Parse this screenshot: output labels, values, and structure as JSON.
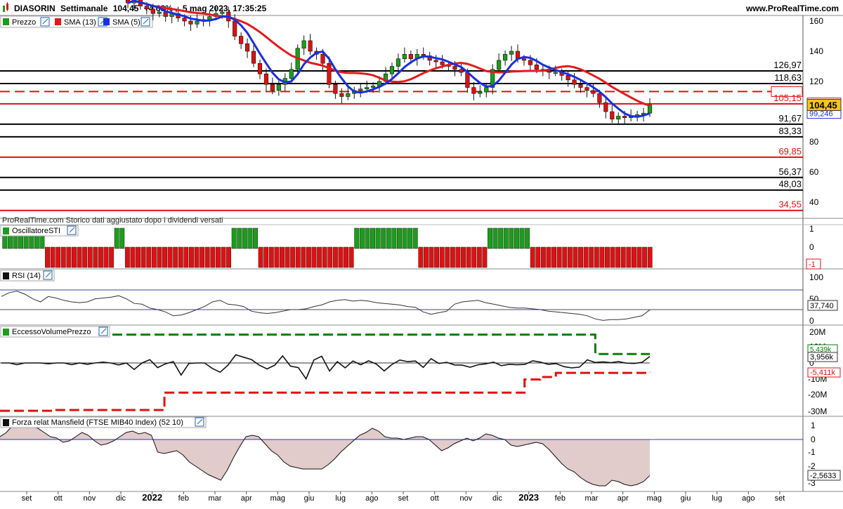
{
  "header": {
    "instrument": "DIASORIN",
    "timeframe": "Settimanale",
    "last": "104,45",
    "change": "+4,68%",
    "datetime": "5 mag 2023, 17:35:25",
    "website": "www.ProRealTime.com"
  },
  "colors": {
    "up": "#1a9e1a",
    "down": "#e01010",
    "sma13": "#e31a1a",
    "sma5": "#1a2fe0",
    "tag_yellow": "#f5c518",
    "area_fill": "#c9a0a0",
    "green_dash": "#0a7d0a",
    "red_dash": "#e01010"
  },
  "price_panel": {
    "legend": [
      "Prezzo",
      "SMA (13)",
      "SMA (5)"
    ],
    "y_ticks": [
      "160",
      "140",
      "120",
      "100",
      "80",
      "60",
      "40"
    ],
    "footer_note": "ProRealTime.com Storico dati aggiustato dopo i dividendi versati",
    "levels": [
      {
        "label": "126,97",
        "value": 126.97,
        "color": "#000000",
        "dashed": false
      },
      {
        "label": "118,63",
        "value": 118.63,
        "color": "#000000",
        "dashed": false
      },
      {
        "label": "113,30",
        "value": 113.3,
        "color": "#e01010",
        "dashed": true
      },
      {
        "label": "105,15",
        "value": 105.15,
        "color": "#e01010",
        "dashed": false
      },
      {
        "label": "91,67",
        "value": 91.67,
        "color": "#000000",
        "dashed": false
      },
      {
        "label": "83,33",
        "value": 83.33,
        "color": "#000000",
        "dashed": false
      },
      {
        "label": "69,85",
        "value": 69.85,
        "color": "#e01010",
        "dashed": false
      },
      {
        "label": "56,37",
        "value": 56.37,
        "color": "#000000",
        "dashed": false
      },
      {
        "label": "48,03",
        "value": 48.03,
        "color": "#000000",
        "dashed": false
      },
      {
        "label": "34,55",
        "value": 34.55,
        "color": "#e01010",
        "dashed": false
      }
    ],
    "tags": {
      "sma13": "105,33",
      "last": "104,45",
      "sma5": "99,246"
    }
  },
  "sti_panel": {
    "title": "OscillatoreSTI",
    "y_ticks": [
      "1",
      "0"
    ],
    "tag_value": "-1",
    "states": "GGGGGGGGRRRRRRRRRRRRRGGRRRRRRRRRRRRRRRRRRRRGGGGGRRRRRRRRRRRRRRRRRRGGGGGGGGGGGGRRRRRRRRRRRRRGGGGGGGGRRRRRRRRRRRRRRRRRRRRRRR"
  },
  "rsi_panel": {
    "title": "RSI (14)",
    "y_ticks": [
      "100",
      "50",
      "0"
    ],
    "last": "37,740"
  },
  "volume_panel": {
    "title": "EccessoVolumePrezzo",
    "y_ticks": [
      "20M",
      "10M",
      "0",
      "-10M",
      "-20M",
      "-30M"
    ],
    "tags": {
      "upper": "5,439k",
      "last": "3,956k",
      "lower": "-5,411k"
    }
  },
  "mansfield_panel": {
    "title": "Forza relat Mansfield (FTSE MIB40 Index) (52 10)",
    "y_ticks": [
      "1",
      "0",
      "-1",
      "-2",
      "-3"
    ],
    "last": "-2,5633"
  },
  "x_axis": {
    "labels": [
      "set",
      "ott",
      "nov",
      "dic",
      "2022",
      "feb",
      "mar",
      "apr",
      "mag",
      "giu",
      "lug",
      "ago",
      "set",
      "ott",
      "nov",
      "dic",
      "2023",
      "feb",
      "mar",
      "apr",
      "mag",
      "giu",
      "lug",
      "ago",
      "set"
    ],
    "bold_labels": [
      "2022",
      "2023"
    ]
  },
  "chart_data": {
    "type": "candlestick",
    "periodicity": "weekly",
    "price_range": [
      30,
      165
    ],
    "closes": [
      172,
      175,
      170,
      168,
      165,
      166,
      163,
      165,
      162,
      160,
      158,
      160,
      161,
      163,
      165,
      166,
      160,
      150,
      145,
      140,
      132,
      125,
      118,
      114,
      118,
      122,
      128,
      142,
      147,
      140,
      138,
      132,
      118,
      112,
      110,
      112,
      114,
      115,
      116,
      117,
      120,
      125,
      130,
      135,
      138,
      135,
      138,
      137,
      134,
      133,
      131,
      130,
      128,
      126,
      116,
      112,
      113,
      116,
      128,
      134,
      138,
      140,
      135,
      134,
      131,
      128,
      127,
      126,
      126,
      124,
      121,
      118,
      116,
      114,
      112,
      106,
      100,
      95,
      97,
      96,
      97,
      98,
      99,
      104.45
    ],
    "rsi": [
      55,
      60,
      62,
      58,
      52,
      48,
      55,
      53,
      50,
      48,
      47,
      48,
      52,
      53,
      54,
      56,
      52,
      46,
      45,
      40,
      38,
      35,
      30,
      31,
      34,
      38,
      42,
      48,
      50,
      45,
      44,
      42,
      36,
      34,
      33,
      34,
      36,
      38,
      38,
      39,
      42,
      44,
      48,
      50,
      51,
      49,
      50,
      49,
      47,
      46,
      45,
      44,
      42,
      41,
      35,
      32,
      34,
      36,
      45,
      48,
      49,
      50,
      47,
      45,
      43,
      41,
      40,
      40,
      39,
      38,
      36,
      35,
      34,
      33,
      32,
      30,
      26,
      24,
      25,
      25,
      26,
      28,
      30,
      37.74
    ],
    "volume_excess": [
      0,
      0,
      -1,
      0,
      0,
      0,
      -0.5,
      0,
      0,
      -1,
      0,
      -0.8,
      0,
      0.5,
      0,
      -1.2,
      0,
      -3.9,
      0,
      2,
      -2.8,
      -0.5,
      0.8,
      -7.3,
      -0.3,
      0,
      0,
      -3.3,
      -5.6,
      -1.3,
      5,
      3.5,
      2.1,
      -1.3,
      -3.6,
      -1.3,
      4.3,
      -1.9,
      -2.8,
      -9.6,
      1.8,
      4.1,
      -4.9,
      0.8,
      -3,
      1.2,
      -1.1,
      1.3,
      -0.7,
      -4.8,
      -0.9,
      1.8,
      0.8,
      1.2,
      -2.7,
      2.6,
      -0.3,
      0.4,
      -1.2,
      -1.3,
      -2.6,
      -1.1,
      -0.5,
      0.5,
      -1.6,
      -0.8,
      -1.1,
      -0.9,
      1.3,
      0.5,
      -0.8,
      -0.4,
      -2.2,
      -3,
      -2.5,
      1.9,
      0.3,
      0.7,
      0.2,
      0.8,
      -0.1,
      -0.3,
      0.4,
      3.956
    ],
    "volume_upper_band": [
      10,
      10,
      10,
      10,
      10,
      10,
      10,
      10,
      10,
      10,
      10,
      10,
      10,
      10,
      10,
      10,
      10,
      10,
      10,
      10,
      10,
      10,
      10,
      10,
      10,
      10,
      10,
      10,
      10,
      10,
      10,
      10,
      10,
      10,
      10,
      10,
      10,
      10,
      10,
      10,
      10,
      10,
      10,
      10,
      10,
      10,
      10,
      10,
      10,
      10,
      10,
      10,
      10,
      10,
      10,
      10,
      10,
      10,
      10,
      10,
      10,
      10,
      10,
      10,
      10,
      10,
      10,
      10,
      10,
      10,
      10,
      10,
      10,
      10,
      10,
      5.4,
      5.4,
      5.4,
      5.4,
      5.4,
      5.4,
      5.4,
      5.4,
      5.4
    ],
    "volume_lower_band": [
      -29,
      -29,
      -29,
      -29,
      -29,
      -29,
      -29,
      -28.5,
      -28.5,
      -28.5,
      -28.5,
      -28.5,
      -28.5,
      -28.5,
      -28.5,
      -28.5,
      -28.5,
      -28.5,
      -28.5,
      -28.5,
      -28.5,
      -18,
      -18,
      -18,
      -18,
      -18,
      -18,
      -18,
      -18,
      -18,
      -18,
      -18,
      -18,
      -18,
      -18,
      -18,
      -18,
      -18,
      -18,
      -18,
      -18,
      -18,
      -18,
      -18,
      -18,
      -18,
      -18,
      -18,
      -18,
      -18,
      -18,
      -18,
      -18,
      -18,
      -18,
      -18,
      -18,
      -18,
      -18,
      -18,
      -18,
      -18,
      -18,
      -18,
      -18,
      -18,
      -18,
      -10,
      -10,
      -8.5,
      -8.5,
      -6,
      -6,
      -6,
      -6,
      -6,
      -6,
      -6,
      -6,
      -6,
      -6,
      -6,
      -6,
      -5.411
    ],
    "mansfield": [
      0.2,
      0.5,
      1,
      1.1,
      1.1,
      1,
      0.8,
      0.5,
      0.2,
      0.1,
      -0.2,
      -0.1,
      0.2,
      0.5,
      0.3,
      -0.1,
      -0.4,
      -0.3,
      -0.1,
      0.2,
      0.5,
      0.6,
      0.4,
      0.5,
      0.3,
      -0.9,
      -1,
      -0.9,
      -0.8,
      -1.1,
      -1.6,
      -1.9,
      -2.2,
      -2.5,
      -2.7,
      -2.9,
      -2.2,
      -1.3,
      -0.5,
      0.2,
      0.3,
      0.2,
      -0.3,
      -0.8,
      -1.1,
      -1.6,
      -1.9,
      -2,
      -2.1,
      -2.1,
      -2.1,
      -2.1,
      -1.8,
      -1.4,
      -0.9,
      -0.5,
      -0.1,
      0.3,
      0.5,
      0.8,
      0.6,
      0.2,
      0.1,
      0.1,
      0,
      0.1,
      0.2,
      0.2,
      0,
      -0.4,
      -0.8,
      -0.6,
      -0.3,
      -0.1,
      0.1,
      -0.1,
      0.1,
      0.4,
      0.3,
      0.1,
      0,
      -0.4,
      -0.5,
      -0.4,
      -0.3,
      -0.2,
      -0.3,
      -0.7,
      -1.2,
      -1.7,
      -2.1,
      -2.3,
      -2.7,
      -3.0,
      -3.2,
      -3.3,
      -3.3,
      -2.9,
      -3.0,
      -3.2,
      -3.3,
      -3.2,
      -3.0,
      -2.5633
    ]
  }
}
